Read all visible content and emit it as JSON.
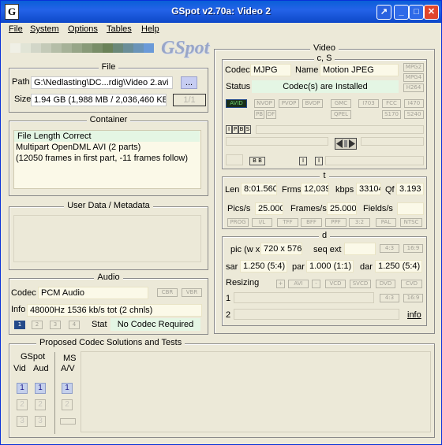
{
  "window": {
    "title": "GSpot v2.70a: Video 2"
  },
  "menu": [
    "File",
    "System",
    "Options",
    "Tables",
    "Help"
  ],
  "logo": "GSpot",
  "file": {
    "caption": "File",
    "path_label": "Path",
    "path_value": "G:\\Nedlasting\\DC...rdig\\Video 2.avi",
    "browse_label": "...",
    "size_label": "Size",
    "size_value": "1.94 GB (1,988 MB / 2,036,460 KB",
    "page_indicator": "1/1"
  },
  "container": {
    "caption": "Container",
    "lines": [
      "File Length Correct",
      "Multipart OpenDML AVI (2 parts)",
      "(12050 frames in first part, -11 frames follow)"
    ]
  },
  "userdata": {
    "caption": "User Data / Metadata"
  },
  "audio": {
    "caption": "Audio",
    "codec_label": "Codec",
    "codec_value": "PCM Audio",
    "cbr": "CBR",
    "vbr": "VBR",
    "info_label": "Info",
    "info_value": "48000Hz  1536 kb/s tot (2 chnls)",
    "streams": [
      "1",
      "2",
      "3",
      "4"
    ],
    "stat_label": "Stat",
    "stat_value": "No Codec Required"
  },
  "video": {
    "caption": "Video",
    "cs_caption": "c, S",
    "codec_label": "Codec",
    "codec_value": "MJPG",
    "name_label": "Name",
    "name_value": "Motion JPEG",
    "status_label": "Status",
    "status_value": "Codec(s) are Installed",
    "mpeg_tags": [
      "MPG2",
      "MPG4",
      "H264"
    ],
    "flags_row1": [
      "AVID",
      "NVOP",
      "PVOP",
      "BVOP",
      "GMC",
      "I703",
      "FCC",
      "I470"
    ],
    "flags_row2": [
      "PB",
      "DF",
      "QPEL",
      "S170",
      "S240"
    ],
    "frame_types": [
      "I",
      "P",
      "B",
      "S"
    ],
    "bb_label": "B B",
    "i_label1": "I",
    "i_label2": "I",
    "t_caption": "t",
    "len_label": "Len",
    "len_value": "8:01.560",
    "frms_label": "Frms",
    "frms_value": "12,039",
    "kbps_label": "kbps",
    "kbps_value": "33104",
    "qf_label": "Qf",
    "qf_value": "3.193",
    "pics_label": "Pics/s",
    "pics_value": "25.000",
    "frames_label": "Frames/s",
    "frames_value": "25.000",
    "fields_label": "Fields/s",
    "fields_value": "",
    "mode_tags": [
      "PROG",
      "I/L",
      "TFF",
      "BFF",
      "PPF",
      "3:2",
      "PAL",
      "NTSC"
    ],
    "d_caption": "d",
    "pic_label": "pic (w x",
    "pic_value": "720 x 576",
    "seqext_label": "seq ext",
    "ar_tags": [
      "4:3",
      "16:9"
    ],
    "sar_label": "sar",
    "sar_value": "1.250 (5:4)",
    "par_label": "par",
    "par_value": "1.000 (1:1)",
    "dar_label": "dar",
    "dar_value": "1.250 (5:4)",
    "resizing_label": "Resizing",
    "resize_tags": [
      "+",
      "AVI",
      "-",
      "VCD",
      "SVCD",
      "DVD",
      "CVD"
    ],
    "row1_label": "1",
    "row2_label": "2",
    "row1_tags": [
      "4:3",
      "16:9"
    ],
    "info_link": "info"
  },
  "proposed": {
    "caption": "Proposed Codec Solutions and Tests",
    "gspot_label": "GSpot",
    "vid_label": "Vid",
    "aud_label": "Aud",
    "ms_label": "MS",
    "av_label": "A/V",
    "vid_nums": [
      "1",
      "2",
      "3"
    ],
    "aud_nums": [
      "1",
      "2",
      "3"
    ],
    "av_nums": [
      "1",
      "2"
    ]
  },
  "colors": {
    "strip": [
      "#f0f0e6",
      "#e1e4d6",
      "#d2d6c8",
      "#c4cab8",
      "#b5bea8",
      "#a6b298",
      "#97a688",
      "#889a78",
      "#798e68",
      "#6a8258",
      "#6a8878",
      "#6a8e98",
      "#6a94b8",
      "#6a9ad8"
    ]
  }
}
